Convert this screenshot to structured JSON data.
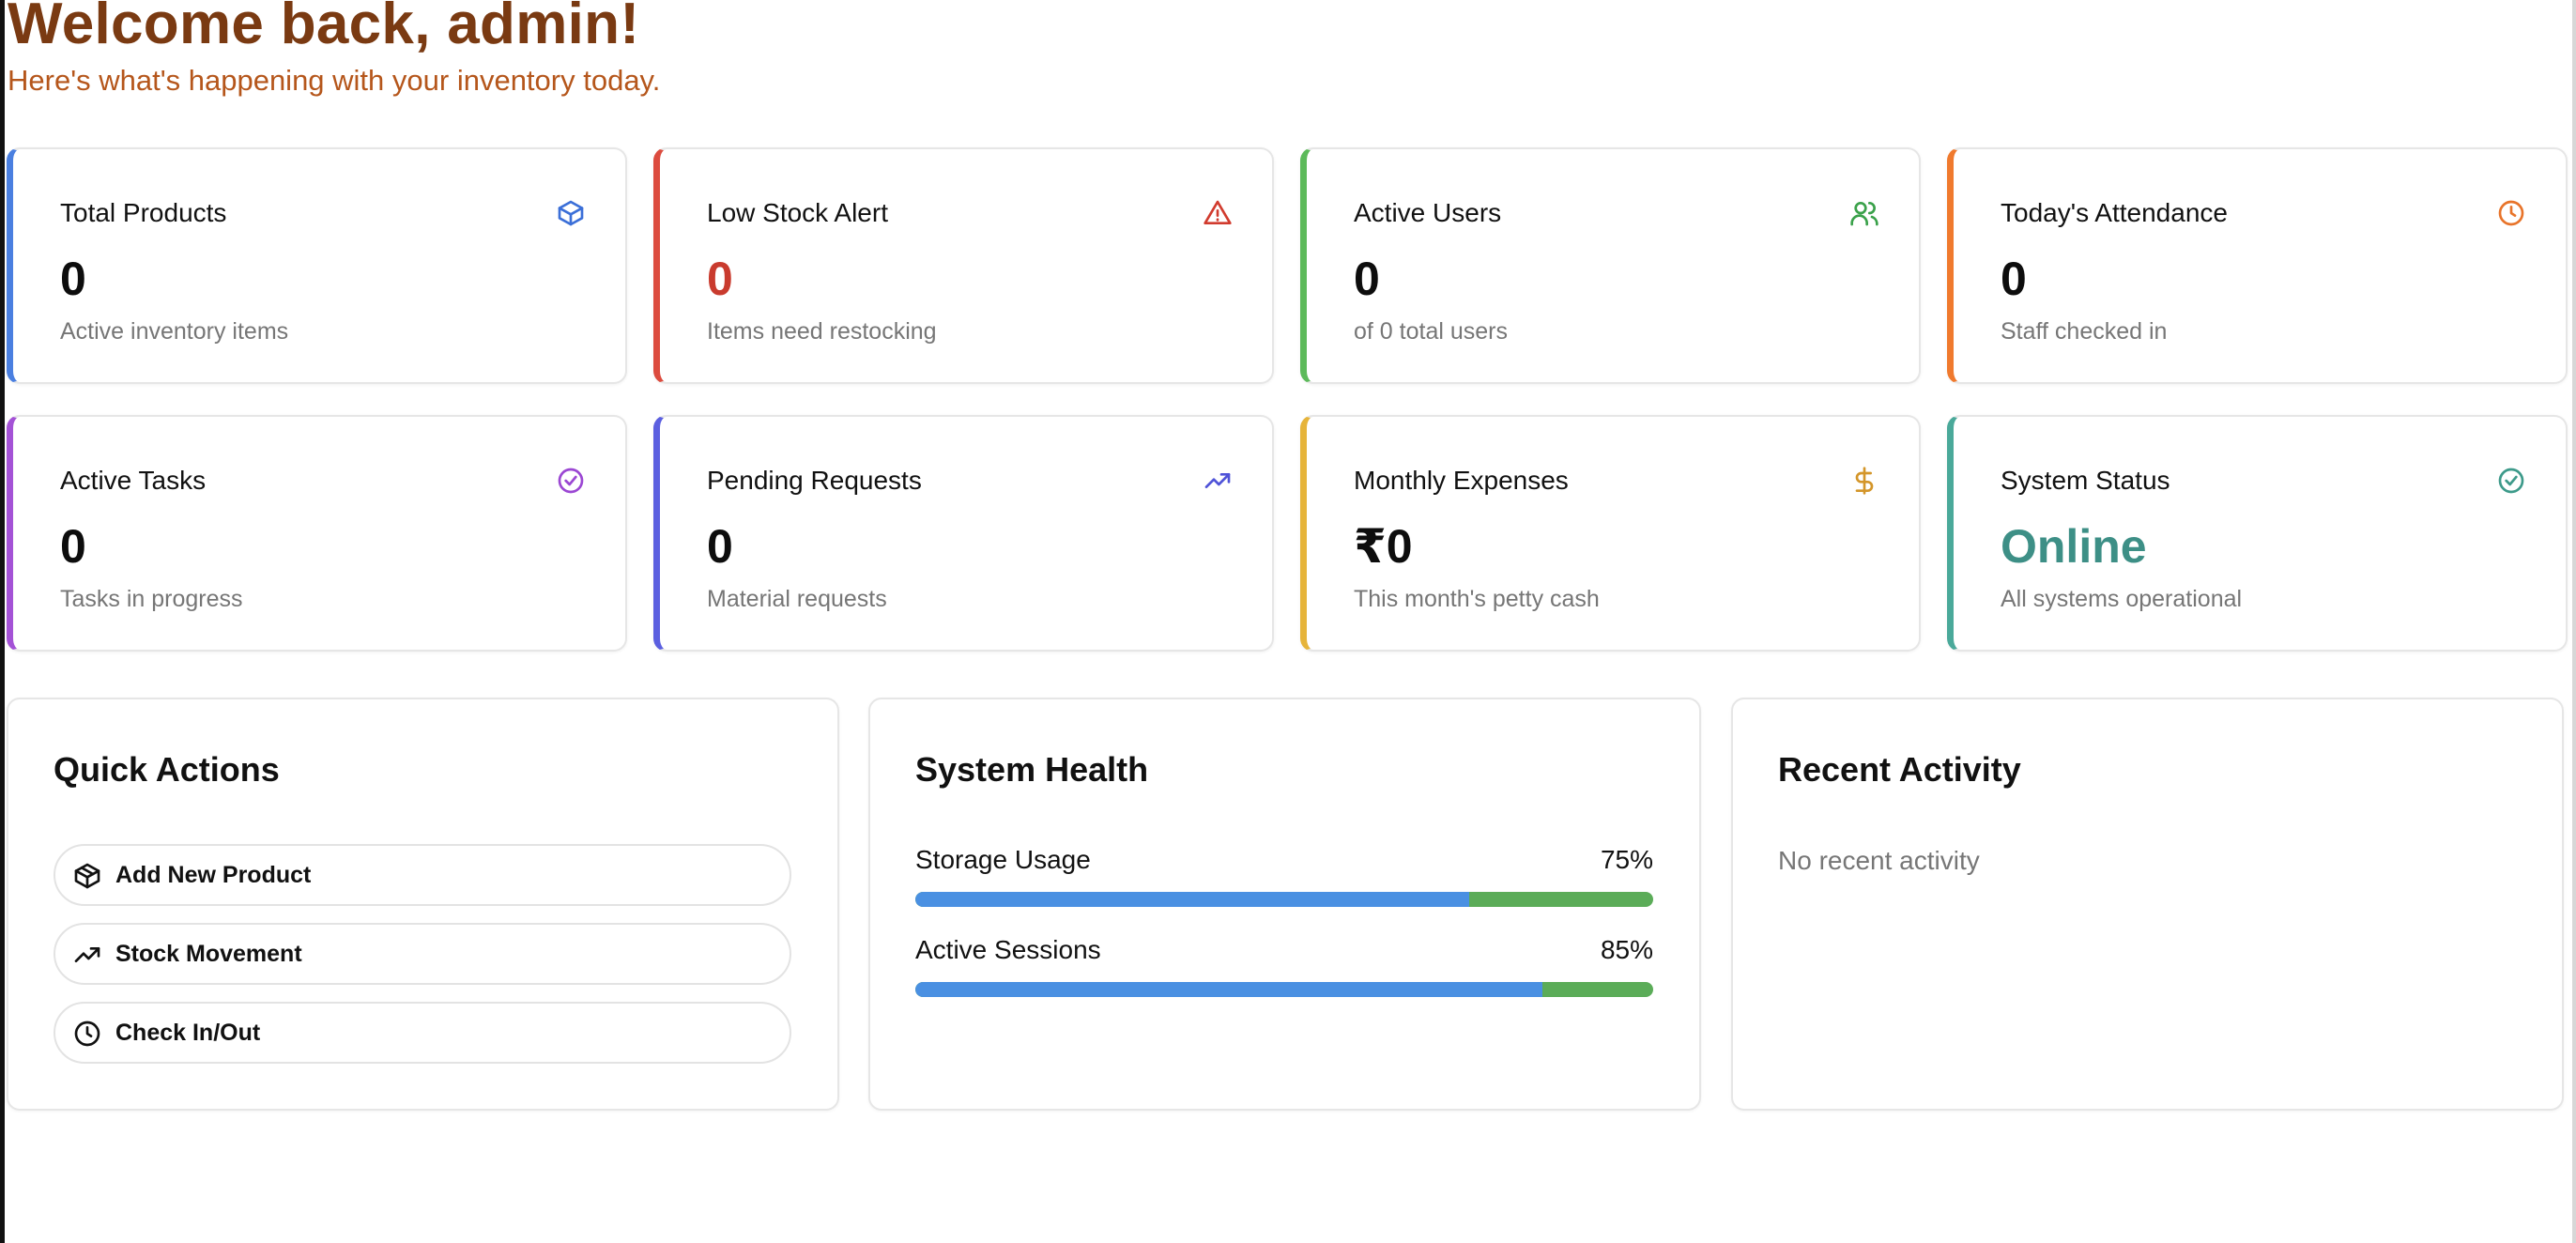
{
  "header": {
    "title": "Welcome back, admin!",
    "subtitle": "Here's what's happening with your inventory today."
  },
  "stats": [
    {
      "label": "Total Products",
      "value": "0",
      "sub": "Active inventory items",
      "icon": "box-icon",
      "accent": "#4a7fe0",
      "value_color": "#0d0d0d",
      "icon_color": "#3b6fd8"
    },
    {
      "label": "Low Stock Alert",
      "value": "0",
      "sub": "Items need restocking",
      "icon": "alert-triangle-icon",
      "accent": "#dc4b3e",
      "value_color": "#c93b2e",
      "icon_color": "#d13b2e"
    },
    {
      "label": "Active Users",
      "value": "0",
      "sub": "of 0 total users",
      "icon": "users-icon",
      "accent": "#5cba5a",
      "value_color": "#0d0d0d",
      "icon_color": "#3aa14a"
    },
    {
      "label": "Today's Attendance",
      "value": "0",
      "sub": "Staff checked in",
      "icon": "clock-icon",
      "accent": "#f07a2e",
      "value_color": "#0d0d0d",
      "icon_color": "#e8742a"
    },
    {
      "label": "Active Tasks",
      "value": "0",
      "sub": "Tasks in progress",
      "icon": "check-circle-icon",
      "accent": "#a452d6",
      "value_color": "#0d0d0d",
      "icon_color": "#9b47d3"
    },
    {
      "label": "Pending Requests",
      "value": "0",
      "sub": "Material requests",
      "icon": "trending-up-icon",
      "accent": "#5b5fe0",
      "value_color": "#0d0d0d",
      "icon_color": "#4f53d8"
    },
    {
      "label": "Monthly Expenses",
      "value": "₹0",
      "sub": "This month's petty cash",
      "icon": "dollar-icon",
      "accent": "#e6b43a",
      "value_color": "#0d0d0d",
      "icon_color": "#d4962a"
    },
    {
      "label": "System Status",
      "value": "Online",
      "sub": "All systems operational",
      "icon": "check-circle-icon",
      "accent": "#4aa99a",
      "value_color": "#3d8f86",
      "icon_color": "#3d9a8a"
    }
  ],
  "quick_actions": {
    "title": "Quick Actions",
    "items": [
      {
        "label": "Add New Product",
        "icon": "box-icon"
      },
      {
        "label": "Stock Movement",
        "icon": "trending-up-icon"
      },
      {
        "label": "Check In/Out",
        "icon": "clock-icon"
      }
    ]
  },
  "system_health": {
    "title": "System Health",
    "metrics": [
      {
        "label": "Storage Usage",
        "value_text": "75%",
        "value": 0.75
      },
      {
        "label": "Active Sessions",
        "value_text": "85%",
        "value": 0.85
      }
    ],
    "bar_fill_color": "#4a90e2",
    "bar_track_color": "#5bac58"
  },
  "recent_activity": {
    "title": "Recent Activity",
    "empty_text": "No recent activity"
  }
}
